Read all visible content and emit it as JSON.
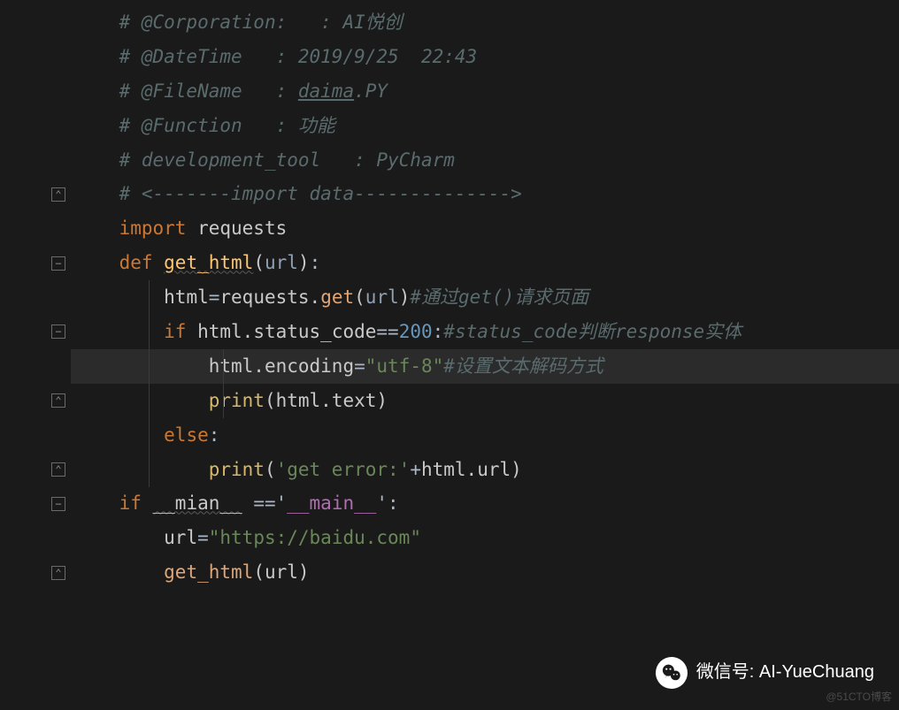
{
  "code": {
    "lines": [
      {
        "ind": 1,
        "fold": null,
        "segs": [
          {
            "cls": "c-comment",
            "t": "# @Corporation:   : AI悦创"
          }
        ]
      },
      {
        "ind": 1,
        "fold": null,
        "segs": [
          {
            "cls": "c-comment",
            "t": "# @DateTime   : 2019/9/25  22:43"
          }
        ]
      },
      {
        "ind": 1,
        "fold": null,
        "segs": [
          {
            "cls": "c-comment",
            "t": "# @FileName   : "
          },
          {
            "cls": "c-comment underline",
            "t": "daima"
          },
          {
            "cls": "c-comment",
            "t": ".PY"
          }
        ]
      },
      {
        "ind": 1,
        "fold": null,
        "segs": [
          {
            "cls": "c-comment",
            "t": "# @Function   : 功能"
          }
        ]
      },
      {
        "ind": 1,
        "fold": null,
        "segs": [
          {
            "cls": "c-comment",
            "t": "# development_tool   : PyCharm"
          }
        ]
      },
      {
        "ind": 1,
        "fold": "end",
        "segs": [
          {
            "cls": "c-comment",
            "t": "# <-------import data-------------->"
          }
        ]
      },
      {
        "ind": 1,
        "fold": null,
        "segs": [
          {
            "cls": "c-keyword",
            "t": "import "
          },
          {
            "cls": "c-ident",
            "t": "requests"
          }
        ]
      },
      {
        "ind": 1,
        "fold": "start",
        "segs": [
          {
            "cls": "c-keyword",
            "t": "def "
          },
          {
            "cls": "c-defname underline-wave",
            "t": "get_html"
          },
          {
            "cls": "c-punct",
            "t": "("
          },
          {
            "cls": "c-param",
            "t": "url"
          },
          {
            "cls": "c-punct",
            "t": ")"
          },
          {
            "cls": "c-op",
            "t": ":"
          }
        ]
      },
      {
        "ind": 2,
        "fold": null,
        "segs": [
          {
            "cls": "c-ident",
            "t": "html"
          },
          {
            "cls": "c-op",
            "t": "="
          },
          {
            "cls": "c-ident",
            "t": "requests"
          },
          {
            "cls": "c-punct",
            "t": "."
          },
          {
            "cls": "c-func",
            "t": "get"
          },
          {
            "cls": "c-punct",
            "t": "("
          },
          {
            "cls": "c-param",
            "t": "url"
          },
          {
            "cls": "c-punct",
            "t": ")"
          },
          {
            "cls": "c-comment",
            "t": "#通过get()请求页面"
          }
        ]
      },
      {
        "ind": 2,
        "fold": "start",
        "segs": [
          {
            "cls": "c-keyword",
            "t": "if "
          },
          {
            "cls": "c-ident",
            "t": "html"
          },
          {
            "cls": "c-punct",
            "t": "."
          },
          {
            "cls": "c-ident",
            "t": "status_code"
          },
          {
            "cls": "c-op",
            "t": "=="
          },
          {
            "cls": "c-number",
            "t": "200"
          },
          {
            "cls": "c-op",
            "t": ":"
          },
          {
            "cls": "c-comment",
            "t": "#status_code判断response实体"
          }
        ]
      },
      {
        "ind": 3,
        "fold": null,
        "hl": true,
        "segs": [
          {
            "cls": "c-ident",
            "t": "html"
          },
          {
            "cls": "c-punct",
            "t": "."
          },
          {
            "cls": "c-ident",
            "t": "encoding"
          },
          {
            "cls": "c-op",
            "t": "="
          },
          {
            "cls": "c-string",
            "t": "\"utf-8\""
          },
          {
            "cls": "c-comment",
            "t": "#设置文本解码方式"
          }
        ]
      },
      {
        "ind": 3,
        "fold": "end",
        "segs": [
          {
            "cls": "c-builtin",
            "t": "print"
          },
          {
            "cls": "c-punct",
            "t": "("
          },
          {
            "cls": "c-ident",
            "t": "html"
          },
          {
            "cls": "c-punct",
            "t": "."
          },
          {
            "cls": "c-ident",
            "t": "text"
          },
          {
            "cls": "c-punct",
            "t": ")"
          }
        ]
      },
      {
        "ind": 2,
        "fold": null,
        "segs": [
          {
            "cls": "c-keyword",
            "t": "else"
          },
          {
            "cls": "c-op",
            "t": ":"
          }
        ]
      },
      {
        "ind": 3,
        "fold": "end",
        "segs": [
          {
            "cls": "c-builtin",
            "t": "print"
          },
          {
            "cls": "c-punct",
            "t": "("
          },
          {
            "cls": "c-string",
            "t": "'get error:'"
          },
          {
            "cls": "c-op",
            "t": "+"
          },
          {
            "cls": "c-ident",
            "t": "html"
          },
          {
            "cls": "c-punct",
            "t": "."
          },
          {
            "cls": "c-ident",
            "t": "url"
          },
          {
            "cls": "c-punct",
            "t": ")"
          }
        ]
      },
      {
        "ind": 1,
        "fold": "start",
        "segs": [
          {
            "cls": "c-keyword",
            "t": "if "
          },
          {
            "cls": "c-ident underline-wave",
            "t": "__mian__"
          },
          {
            "cls": "c-op",
            "t": " =='"
          },
          {
            "cls": "c-dunder",
            "t": "__main__"
          },
          {
            "cls": "c-op",
            "t": "':"
          }
        ]
      },
      {
        "ind": 2,
        "fold": null,
        "segs": [
          {
            "cls": "c-ident",
            "t": "url"
          },
          {
            "cls": "c-op",
            "t": "="
          },
          {
            "cls": "c-string",
            "t": "\"https://baidu.com\""
          }
        ]
      },
      {
        "ind": 2,
        "fold": "end",
        "segs": [
          {
            "cls": "c-func",
            "t": "get_html"
          },
          {
            "cls": "c-punct",
            "t": "("
          },
          {
            "cls": "c-ident",
            "t": "url"
          },
          {
            "cls": "c-punct",
            "t": ")"
          }
        ]
      }
    ]
  },
  "fold_icons": {
    "start": "−",
    "end": "⌃"
  },
  "wechat": {
    "label": "微信号: AI-YueChuang"
  },
  "watermark": {
    "text": "@51CTO博客"
  },
  "colors": {
    "bg": "#1a1a1a",
    "hl": "#2b2b2b"
  }
}
